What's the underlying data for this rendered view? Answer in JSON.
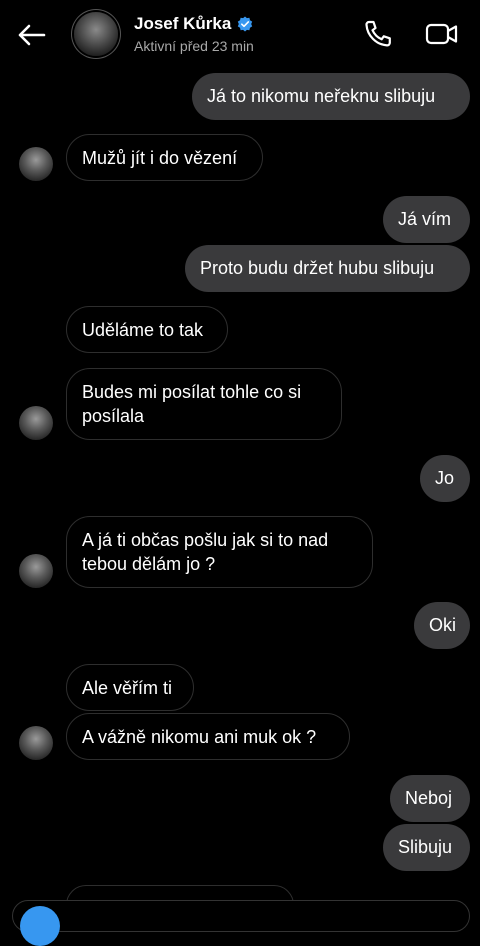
{
  "header": {
    "name": "Josef Kůrka",
    "status": "Aktivní před 23 min"
  },
  "messages": [
    {
      "side": "out",
      "text": "Já to nikomu neřeknu slibuju"
    },
    {
      "side": "in",
      "text": "Mužů jít i do vězení"
    },
    {
      "side": "out",
      "text": "Já vím"
    },
    {
      "side": "out",
      "text": "Proto budu držet hubu slibuju"
    },
    {
      "side": "in",
      "text": "Uděláme to tak"
    },
    {
      "side": "in",
      "line1": "Budes mi posílat tohle co si",
      "line2": "posílala"
    },
    {
      "side": "out",
      "text": "Jo"
    },
    {
      "side": "in",
      "line1": "A já ti občas pošlu jak si to nad",
      "line2": "tebou dělám jo ?"
    },
    {
      "side": "out",
      "text": "Oki"
    },
    {
      "side": "in",
      "text": "Ale věřím ti"
    },
    {
      "side": "in",
      "text": "A vážně nikomu ani muk ok ?"
    },
    {
      "side": "out",
      "text": "Neboj"
    },
    {
      "side": "out",
      "text": "Slibuju"
    }
  ]
}
